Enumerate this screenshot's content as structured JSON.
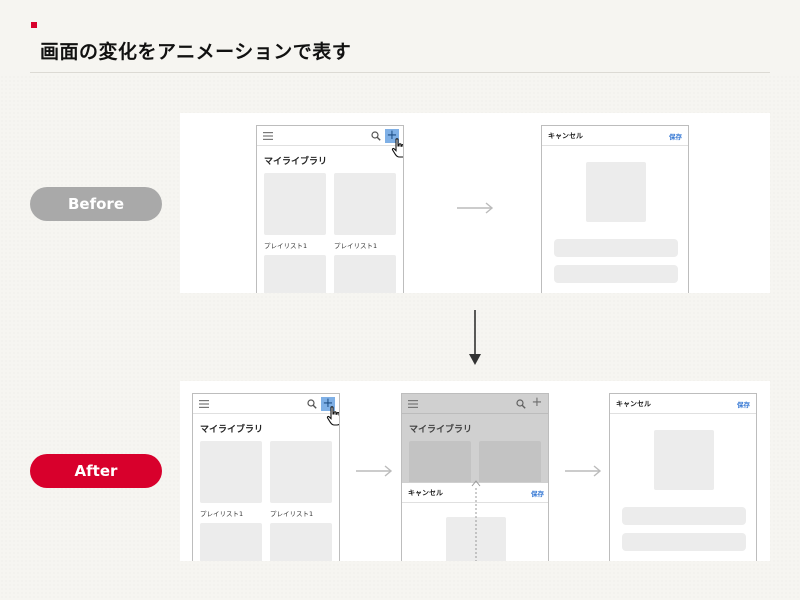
{
  "page": {
    "title": "画面の変化をアニメーションで表す"
  },
  "labels": {
    "before": "Before",
    "after": "After"
  },
  "library_screen": {
    "heading": "マイライブラリ",
    "playlist_label": "プレイリスト1"
  },
  "modal_screen": {
    "cancel": "キャンセル",
    "save": "保存"
  },
  "colors": {
    "accent_red": "#d8002c",
    "before_pill": "#a9a9a9",
    "highlight_blue": "#7fb0e6",
    "save_blue": "#3a7bd5"
  },
  "icons": [
    "menu-icon",
    "search-icon",
    "plus-icon",
    "hand-pointer-icon",
    "arrow-right-icon",
    "arrow-down-icon",
    "dashed-arrow-up-icon"
  ]
}
